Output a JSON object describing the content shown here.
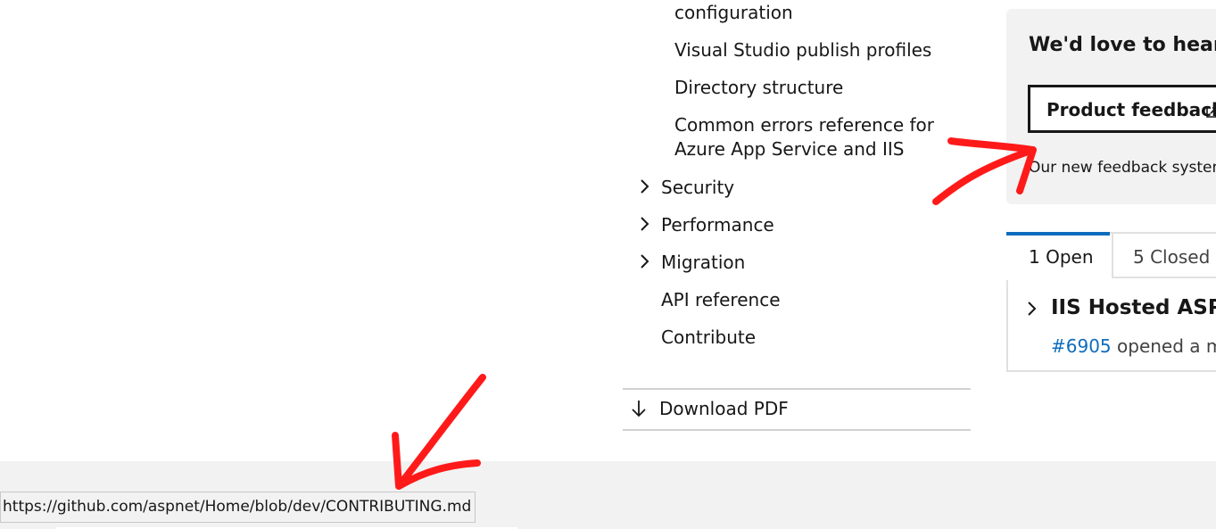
{
  "toc": {
    "items": [
      {
        "label": "configuration"
      },
      {
        "label": "Visual Studio publish profiles"
      },
      {
        "label": "Directory structure"
      },
      {
        "label": "Common errors reference for"
      },
      {
        "label": "Azure App Service and IIS"
      },
      {
        "label": "Security"
      },
      {
        "label": "Performance"
      },
      {
        "label": "Migration"
      },
      {
        "label": "API reference"
      },
      {
        "label": "Contribute"
      }
    ],
    "download_pdf": "Download PDF"
  },
  "feedback": {
    "title": "We'd love to hear y",
    "button_label": "Product feedback",
    "note": "Our new feedback systen"
  },
  "issues": {
    "tab_open": "1 Open",
    "tab_closed": "5 Closed",
    "item_title": "IIS Hosted ASP.N",
    "item_number": "#6905",
    "item_meta": " opened a mo"
  },
  "status_bar": {
    "url": "https://github.com/aspnet/Home/blob/dev/CONTRIBUTING.md"
  },
  "icons": {
    "chevron": "chevron-right-icon",
    "download": "arrow-down-icon",
    "external": "external-link-icon"
  },
  "colors": {
    "accent": "#0f6cbd",
    "annotation": "#ff1a1a",
    "card_bg": "#f2f2f2"
  }
}
